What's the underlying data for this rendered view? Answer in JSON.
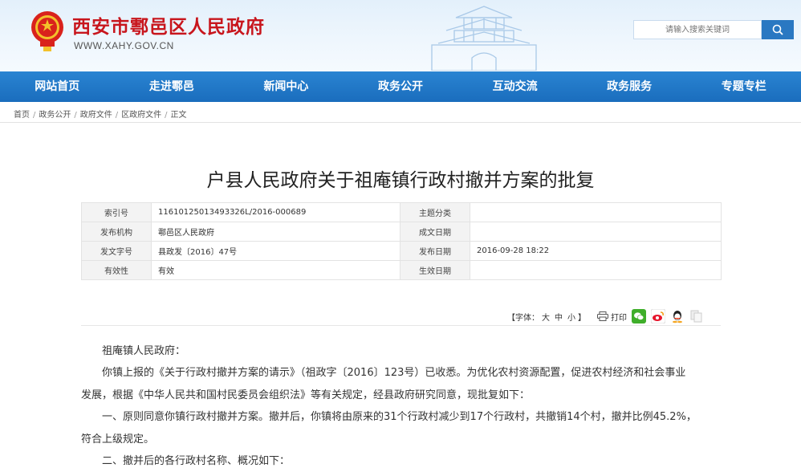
{
  "header": {
    "site_title": "西安市鄠邑区人民政府",
    "site_url": "WWW.XAHY.GOV.CN",
    "search_placeholder": "请输入搜索关键词"
  },
  "nav": {
    "items": [
      "网站首页",
      "走进鄠邑",
      "新闻中心",
      "政务公开",
      "互动交流",
      "政务服务",
      "专题专栏"
    ]
  },
  "breadcrumb": [
    "首页",
    "政务公开",
    "政府文件",
    "区政府文件",
    "正文"
  ],
  "article": {
    "title": "户县人民政府关于祖庵镇行政村撤并方案的批复",
    "meta": {
      "index_label": "索引号",
      "index_value": "11610125013493326L/2016-000689",
      "topic_label": "主题分类",
      "topic_value": "",
      "publisher_label": "发布机构",
      "publisher_value": "鄠邑区人民政府",
      "written_label": "成文日期",
      "written_value": "",
      "docno_label": "发文字号",
      "docno_value": "县政发〔2016〕47号",
      "pubdate_label": "发布日期",
      "pubdate_value": "2016-09-28 18:22",
      "valid_label": "有效性",
      "valid_value": "有效",
      "effective_label": "生效日期",
      "effective_value": ""
    },
    "tools": {
      "font_label": "【字体：",
      "font_large": "大",
      "font_medium": "中",
      "font_small": "小",
      "font_close": "】",
      "print_label": "打印"
    },
    "paragraphs": {
      "salutation": "祖庵镇人民政府：",
      "p1_line1": "你镇上报的《关于行政村撤并方案的请示》（祖政字〔2016〕123号）已收悉。为优化农村资源配置，促进农村经济和社会事业",
      "p1_line2": "发展，根据《中华人民共和国村民委员会组织法》等有关规定，经县政府研究同意，现批复如下：",
      "p2_line1": "一、原则同意你镇行政村撤并方案。撤并后，你镇将由原来的31个行政村减少到17个行政村，共撤销14个村，撤并比例45.2%，",
      "p2_line2": "符合上级规定。",
      "p3_line1": "二、撤并后的各行政村名称、概况如下："
    }
  },
  "colors": {
    "brand_red": "#c8161d",
    "nav_blue": "#1f74c4",
    "search_btn": "#2a78c2"
  }
}
